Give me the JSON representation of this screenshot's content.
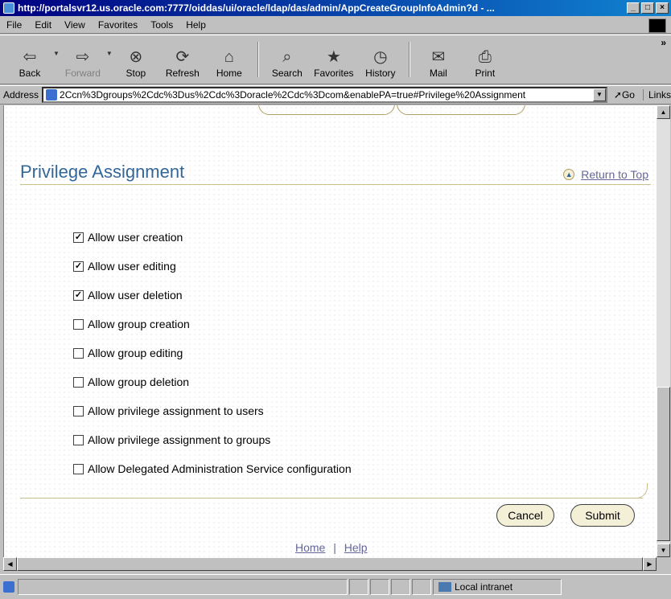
{
  "window": {
    "title": "http://portalsvr12.us.oracle.com:7777/oiddas/ui/oracle/ldap/das/admin/AppCreateGroupInfoAdmin?d - ...",
    "controls": [
      "_",
      "□",
      "×"
    ]
  },
  "menu": [
    "File",
    "Edit",
    "View",
    "Favorites",
    "Tools",
    "Help"
  ],
  "toolbar": {
    "buttons": [
      {
        "label": "Back",
        "icon": "back-arrow-icon"
      },
      {
        "label": "Forward",
        "icon": "forward-arrow-icon",
        "disabled": true
      },
      {
        "label": "Stop",
        "icon": "stop-icon"
      },
      {
        "label": "Refresh",
        "icon": "refresh-icon"
      },
      {
        "label": "Home",
        "icon": "home-icon"
      },
      {
        "label": "Search",
        "icon": "search-icon"
      },
      {
        "label": "Favorites",
        "icon": "favorites-icon"
      },
      {
        "label": "History",
        "icon": "history-icon"
      },
      {
        "label": "Mail",
        "icon": "mail-icon"
      },
      {
        "label": "Print",
        "icon": "print-icon"
      }
    ]
  },
  "address": {
    "label": "Address",
    "url": "2Ccn%3Dgroups%2Cdc%3Dus%2Cdc%3Doracle%2Cdc%3Dcom&enablePA=true#Privilege%20Assignment",
    "go_label": "Go",
    "links_label": "Links"
  },
  "section": {
    "title": "Privilege Assignment",
    "return_to_top": "Return to Top"
  },
  "privileges": [
    {
      "label": "Allow user creation",
      "checked": true
    },
    {
      "label": "Allow user editing",
      "checked": true
    },
    {
      "label": "Allow user deletion",
      "checked": true
    },
    {
      "label": "Allow group creation",
      "checked": false
    },
    {
      "label": "Allow group editing",
      "checked": false
    },
    {
      "label": "Allow group deletion",
      "checked": false
    },
    {
      "label": "Allow privilege assignment to users",
      "checked": false
    },
    {
      "label": "Allow privilege assignment to groups",
      "checked": false
    },
    {
      "label": "Allow Delegated Administration Service configuration",
      "checked": false
    }
  ],
  "actions": {
    "cancel": "Cancel",
    "submit": "Submit"
  },
  "footer": {
    "home": "Home",
    "separator": "|",
    "help": "Help"
  },
  "status": {
    "zone": "Local intranet"
  }
}
